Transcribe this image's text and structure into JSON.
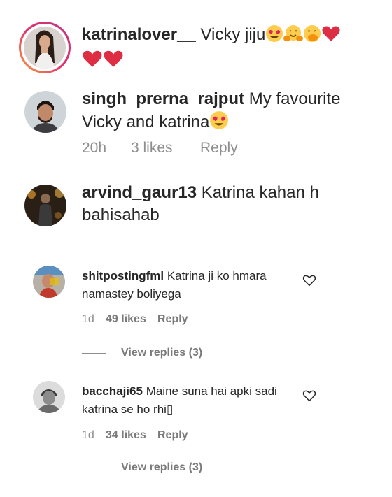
{
  "comments": [
    {
      "username": "katrinalover__",
      "text": "Vicky jiju",
      "emojis": [
        "heart-eyes-emoji",
        "hugging-face-emoji",
        "face-with-hand-over-mouth-emoji",
        "red-heart-emoji",
        "red-heart-emoji",
        "red-heart-emoji"
      ]
    },
    {
      "username": "singh_prerna_rajput",
      "text": "My favourite Vicky and katrina",
      "emojis": [
        "heart-eyes-emoji"
      ],
      "time": "20h",
      "likes": "3 likes",
      "reply": "Reply"
    },
    {
      "username": "arvind_gaur13",
      "text": "Katrina kahan h bahisahab"
    },
    {
      "username": "shitpostingfml",
      "text": "Katrina ji ko hmara namastey boliyega",
      "time": "1d",
      "likes": "49 likes",
      "reply": "Reply",
      "view_replies": "View replies (3)",
      "like_icon": "heart-outline-icon"
    },
    {
      "username": "bacchaji65",
      "text": "Maine suna hai apki sadi katrina se ho rhi▯",
      "time": "1d",
      "likes": "34 likes",
      "reply": "Reply",
      "view_replies": "View replies (3)",
      "like_icon": "heart-outline-icon"
    }
  ],
  "colors": {
    "text": "#262626",
    "muted": "#8e8e8e",
    "heart": "#ed4956",
    "story_ring_start": "#f9a03f",
    "story_ring_end": "#d62976"
  }
}
